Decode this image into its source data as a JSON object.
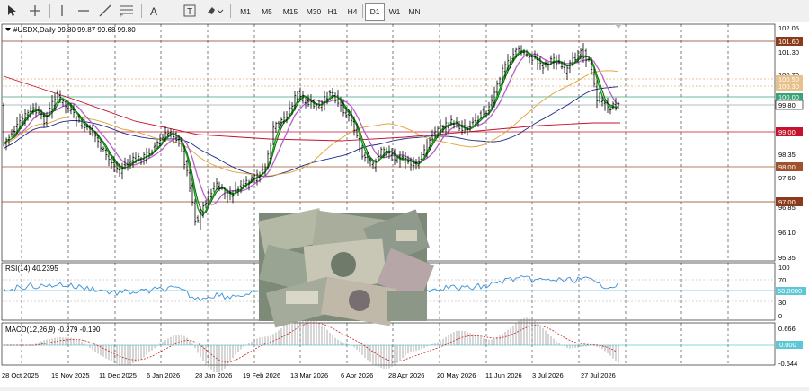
{
  "toolbar": {
    "tools": [
      "cursor-icon",
      "crosshair-icon",
      "vertical-line-icon",
      "horizontal-line-icon",
      "trendline-icon",
      "fibonacci-icon",
      "text-icon",
      "text-label-icon",
      "shapes-icon"
    ],
    "timeframes": [
      "M1",
      "M5",
      "M15",
      "M30",
      "H1",
      "H4",
      "D1",
      "W1",
      "MN"
    ],
    "active_timeframe": "D1"
  },
  "chart": {
    "header": "#USDX,Daily  99.80 99.87 99.68 99.80",
    "y_ticks": [
      "102.05",
      "101.30",
      "100.70",
      "99.80",
      "98.35",
      "97.60",
      "96.85",
      "96.10",
      "95.35"
    ],
    "x_ticks": [
      "28 Oct 2025",
      "19 Nov 2025",
      "11 Dec 2025",
      "6 Jan 2026",
      "28 Jan 2026",
      "19 Feb 2026",
      "13 Mar 2026",
      "6 Apr 2026",
      "28 Apr 2026",
      "20 May 2026",
      "11 Jun 2026",
      "3 Jul 2026",
      "27 Jul 2026"
    ],
    "levels": [
      {
        "label": "101.60",
        "color": "#8b3a1a"
      },
      {
        "label": "100.50",
        "color": "#e0b070"
      },
      {
        "label": "100.30",
        "color": "#e0b070"
      },
      {
        "label": "100.00",
        "color": "#3aa37a"
      },
      {
        "label": "99.80",
        "color": "#000000"
      },
      {
        "label": "99.00",
        "color": "#c4122f"
      },
      {
        "label": "98.00",
        "color": "#a0522d"
      },
      {
        "label": "97.00",
        "color": "#8b3a1a"
      }
    ]
  },
  "rsi": {
    "header": "RSI(14) 40.2395",
    "y_ticks": [
      "100",
      "70",
      "30",
      "0"
    ],
    "level_label": "50.0000"
  },
  "macd": {
    "header": "MACD(12,26,9) -0.279 -0.190",
    "y_ticks": [
      "0.666",
      "-0.644"
    ],
    "level_label": "0.000"
  },
  "overlay_image": {
    "description": "banknotes-photo"
  },
  "colors": {
    "candle": "#000000",
    "ma_green": "#1a9e1a",
    "ma_purple": "#b45fc8",
    "ma_orange": "#e0a030",
    "ma_navy": "#1b2a8a",
    "ma_red": "#c4122f",
    "rsi": "#3d8fd6",
    "macd_signal": "#cc2222"
  }
}
